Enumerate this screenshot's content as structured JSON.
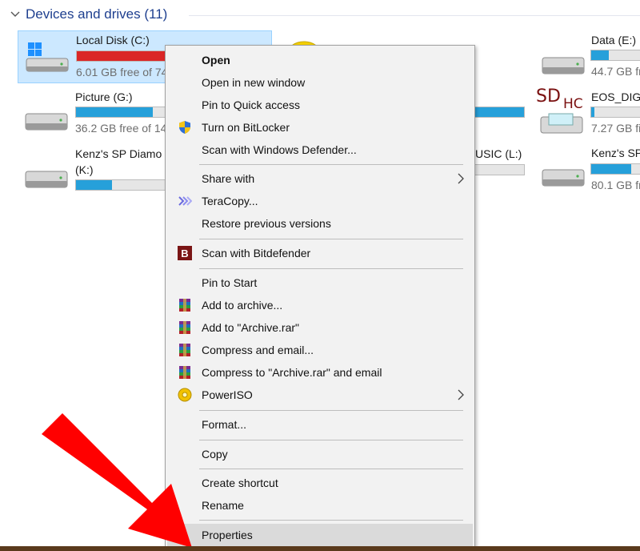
{
  "section": {
    "title": "Devices and drives (11)"
  },
  "drives": {
    "c": {
      "name": "Local Disk (C:)",
      "free": "6.01 GB free of 74",
      "fill": 0.92
    },
    "g": {
      "name": "Picture (G:)",
      "free": "36.2 GB free of 14",
      "fill": 0.75
    },
    "k": {
      "name_line1": "Kenz's SP Diamo",
      "name_line2": "(K:)",
      "fill": 0.35
    },
    "l": {
      "name": "USIC (L:)",
      "fill": 0.0
    },
    "e": {
      "name": "Data (E:)",
      "free": "44.7 GB fr",
      "fill": 0.35
    },
    "eos": {
      "name": "EOS_DIGI",
      "free": "7.27 GB fi",
      "fill": 0.06,
      "sd_badge_sd": "SD",
      "sd_badge_hc": "HC"
    },
    "kenz2": {
      "name": "Kenz's SP",
      "free": "80.1 GB fr",
      "fill": 0.8
    }
  },
  "menu": {
    "open": "Open",
    "open_new_window": "Open in new window",
    "pin_quick_access": "Pin to Quick access",
    "bitlocker": "Turn on BitLocker",
    "defender": "Scan with Windows Defender...",
    "share_with": "Share with",
    "teracopy": "TeraCopy...",
    "restore": "Restore previous versions",
    "bitdefender": "Scan with Bitdefender",
    "pin_start": "Pin to Start",
    "add_archive": "Add to archive...",
    "add_archive_rar": "Add to \"Archive.rar\"",
    "compress_email": "Compress and email...",
    "compress_rar_email": "Compress to \"Archive.rar\" and email",
    "poweriso": "PowerISO",
    "format": "Format...",
    "copy": "Copy",
    "create_shortcut": "Create shortcut",
    "rename": "Rename",
    "properties": "Properties"
  },
  "icons": {
    "bitdefender_letter": "B"
  },
  "colors": {
    "accent_blue": "#26a0da",
    "full_red": "#da2626",
    "selected_bg": "#cce8ff",
    "header_blue": "#1e3f8f",
    "annotation_arrow": "#ff0000"
  }
}
